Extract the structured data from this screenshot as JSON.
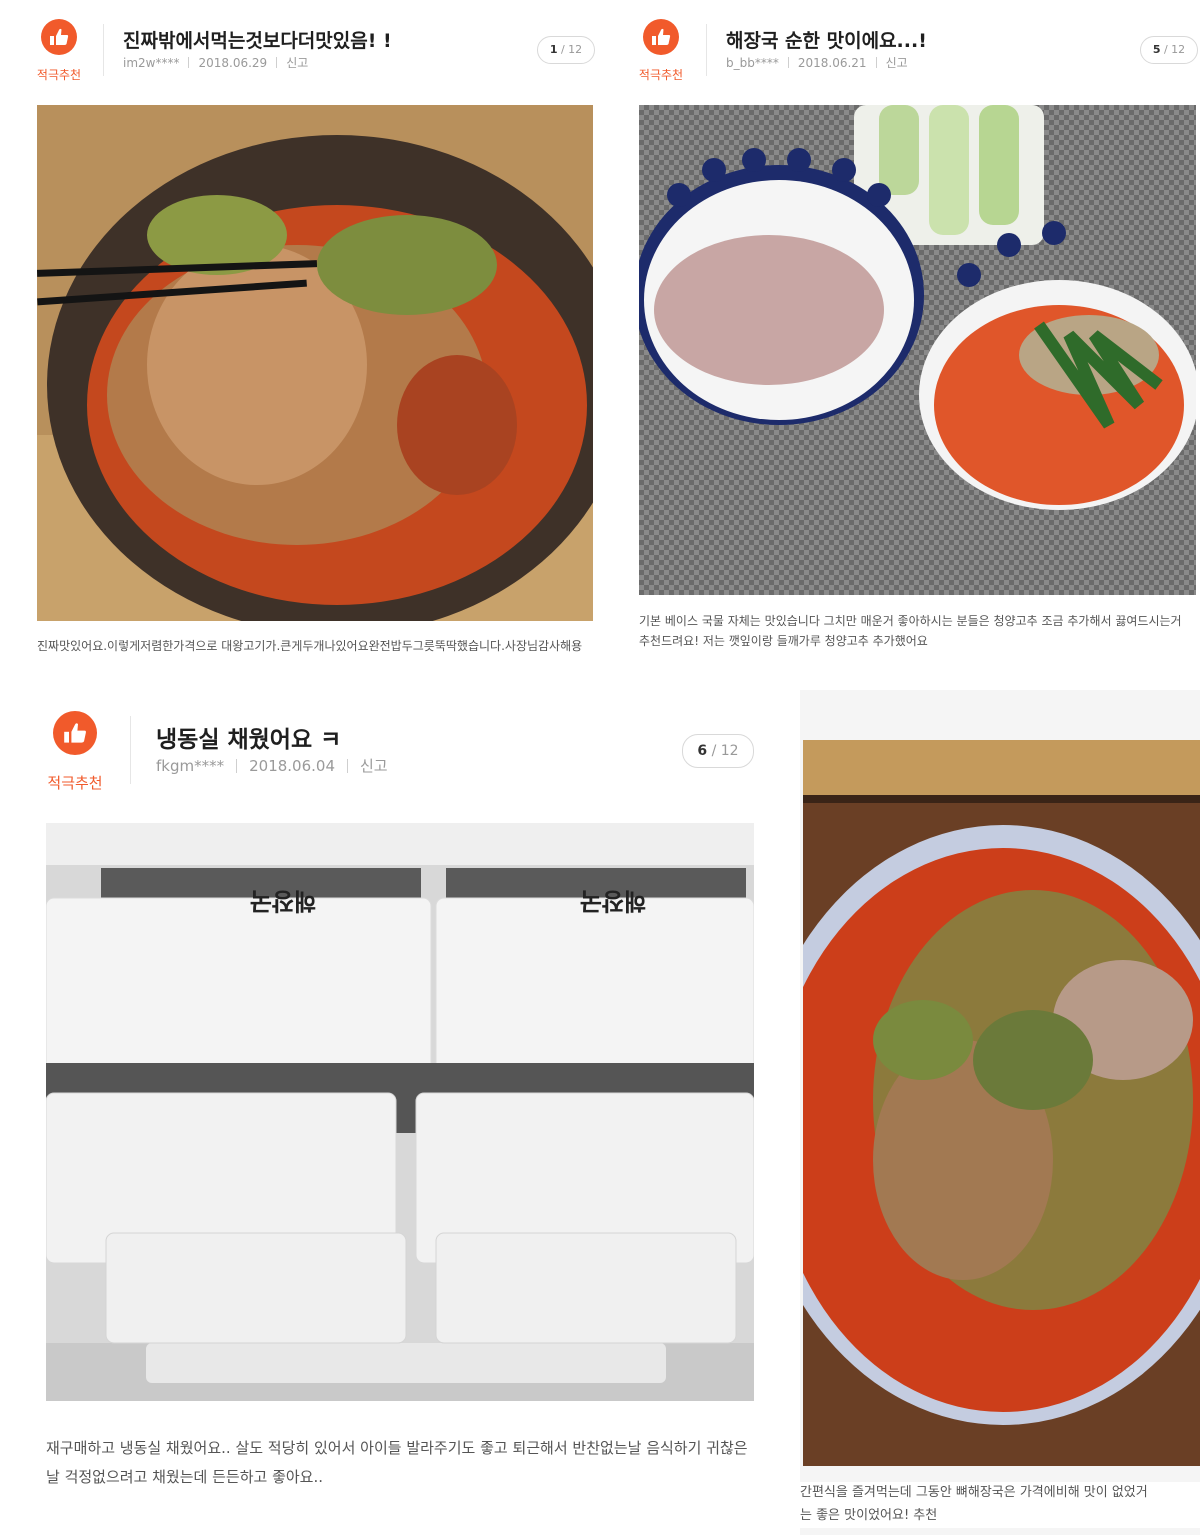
{
  "badge_label": "적극추천",
  "report_label": "신고",
  "reviews": [
    {
      "title": "진짜밖에서먹는것보다더맛있음! !",
      "user": "im2w****",
      "date": "2018.06.29",
      "page_current": "1",
      "page_total": "/ 12",
      "text": "진짜맛있어요.이렇게저렴한가격으로 대왕고기가.큰게두개나있어요완전밥두그릇뚝딱했습니다.사장님감사해용"
    },
    {
      "title": "해장국 순한 맛이에요...!",
      "user": "b_bb****",
      "date": "2018.06.21",
      "page_current": "5",
      "page_total": "/ 12",
      "text": "기본 베이스 국물 자체는 맛있습니다 그치만 매운거 좋아하시는 분들은 청양고추 조금 추가해서 끓여드시는거 추천드려요! 저는 깻잎이랑 들깨가루 청양고추 추가했어요"
    },
    {
      "title": "냉동실 채웠어요 ㅋ",
      "user": "fkgm****",
      "date": "2018.06.04",
      "page_current": "6",
      "page_total": "/ 12",
      "text": "재구매하고 냉동실 채웠어요.. 살도 적당히 있어서 아이들 발라주기도 좋고 퇴근해서 반찬없는날 음식하기 귀찮은날 걱정없으려고 채웠는데 든든하고 좋아요.."
    },
    {
      "text_line1": "간편식을 즐겨먹는데 그동안 뼈해장국은 가격에비해 맛이 없었거",
      "text_line2": "는 좋은 맛이었어요! 추천"
    }
  ],
  "container_label": "해장국",
  "colors": {
    "accent": "#f15a2b",
    "title": "#1f1f1f",
    "meta": "#9a9a9a"
  }
}
